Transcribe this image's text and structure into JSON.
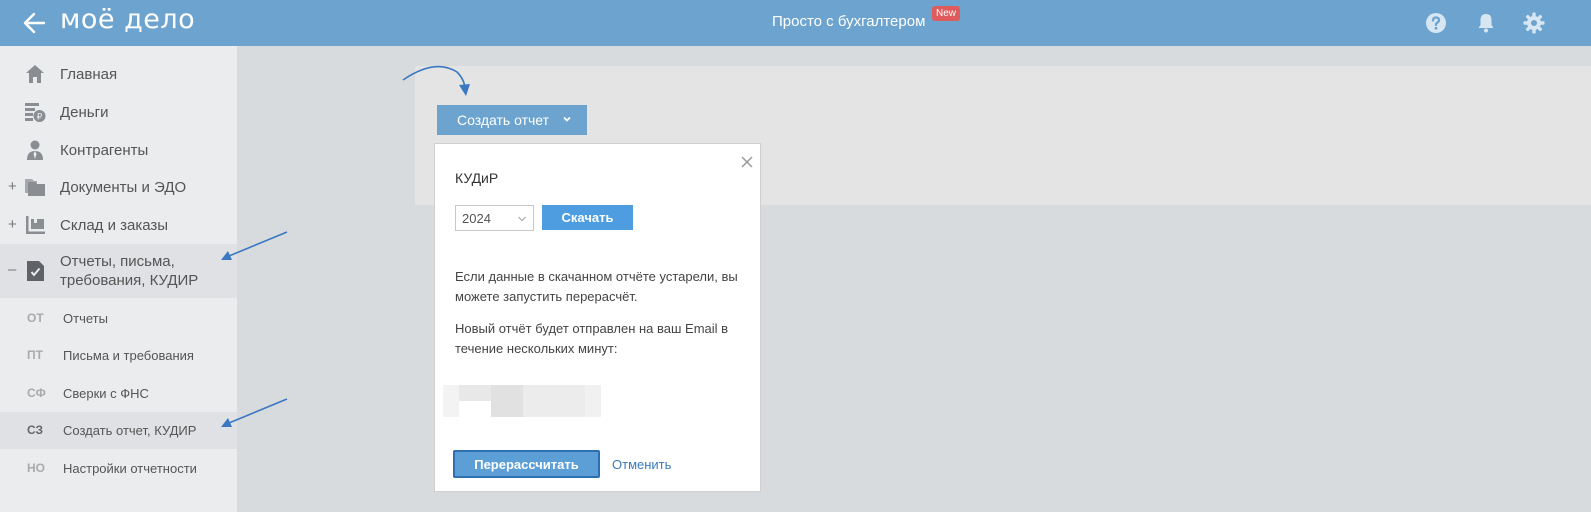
{
  "header": {
    "logo": "моё дело",
    "title": "Просто с бухгалтером",
    "badge": "New"
  },
  "sidebar": {
    "items": [
      {
        "label": "Главная",
        "icon": "home-icon",
        "expander": ""
      },
      {
        "label": "Деньги",
        "icon": "money-icon",
        "expander": ""
      },
      {
        "label": "Контрагенты",
        "icon": "contractor-icon",
        "expander": ""
      },
      {
        "label": "Документы и ЭДО",
        "icon": "folder-icon",
        "expander": "+"
      },
      {
        "label": "Склад и заказы",
        "icon": "warehouse-icon",
        "expander": "+"
      },
      {
        "label": "Отчеты, письма, требования, КУДИР",
        "icon": "report-icon",
        "expander": "–"
      }
    ],
    "subitems": [
      {
        "abbr": "ОТ",
        "label": "Отчеты"
      },
      {
        "abbr": "ПТ",
        "label": "Письма и требования"
      },
      {
        "abbr": "СФ",
        "label": "Сверки с ФНС"
      },
      {
        "abbr": "СЗ",
        "label": "Создать отчет, КУДИР"
      },
      {
        "abbr": "НО",
        "label": "Настройки отчетности"
      }
    ]
  },
  "main": {
    "create_button": "Создать отчет"
  },
  "popup": {
    "title": "КУДиР",
    "year": "2024",
    "download": "Скачать",
    "text1": "Если данные в скачанном отчёте устарели, вы можете запустить перерасчёт.",
    "text2": "Новый отчёт будет отправлен на ваш Email в течение нескольких минут:",
    "recalc": "Перерассчитать",
    "cancel": "Отменить"
  },
  "colors": {
    "header": "#6ca4cf",
    "sidebar": "#ebecee",
    "annotation": "#3a78c2",
    "primary_button": "#4d9de0"
  }
}
